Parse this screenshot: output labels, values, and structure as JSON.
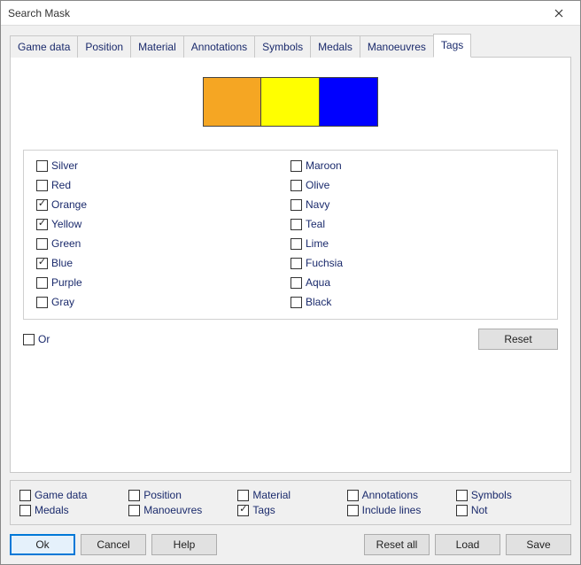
{
  "window": {
    "title": "Search Mask"
  },
  "tabs": [
    {
      "id": "game-data",
      "label": "Game data"
    },
    {
      "id": "position",
      "label": "Position"
    },
    {
      "id": "material",
      "label": "Material"
    },
    {
      "id": "annotations",
      "label": "Annotations"
    },
    {
      "id": "symbols",
      "label": "Symbols"
    },
    {
      "id": "medals",
      "label": "Medals"
    },
    {
      "id": "manoeuvres",
      "label": "Manoeuvres"
    },
    {
      "id": "tags",
      "label": "Tags"
    }
  ],
  "active_tab": "tags",
  "swatches": [
    {
      "name": "orange",
      "color": "#f5a623"
    },
    {
      "name": "yellow",
      "color": "#ffff00"
    },
    {
      "name": "blue",
      "color": "#0000ff"
    }
  ],
  "colors_left": [
    {
      "label": "Silver",
      "checked": false
    },
    {
      "label": "Red",
      "checked": false
    },
    {
      "label": "Orange",
      "checked": true
    },
    {
      "label": "Yellow",
      "checked": true
    },
    {
      "label": "Green",
      "checked": false
    },
    {
      "label": "Blue",
      "checked": true
    },
    {
      "label": "Purple",
      "checked": false
    },
    {
      "label": "Gray",
      "checked": false
    }
  ],
  "colors_right": [
    {
      "label": "Maroon",
      "checked": false
    },
    {
      "label": "Olive",
      "checked": false
    },
    {
      "label": "Navy",
      "checked": false
    },
    {
      "label": "Teal",
      "checked": false
    },
    {
      "label": "Lime",
      "checked": false
    },
    {
      "label": "Fuchsia",
      "checked": false
    },
    {
      "label": "Aqua",
      "checked": false
    },
    {
      "label": "Black",
      "checked": false
    }
  ],
  "or_checkbox": {
    "label": "Or",
    "checked": false
  },
  "reset_btn": "Reset",
  "footer_checks_row1": [
    {
      "label": "Game data",
      "checked": false
    },
    {
      "label": "Position",
      "checked": false
    },
    {
      "label": "Material",
      "checked": false
    },
    {
      "label": "Annotations",
      "checked": false
    },
    {
      "label": "Symbols",
      "checked": false
    }
  ],
  "footer_checks_row2": [
    {
      "label": "Medals",
      "checked": false
    },
    {
      "label": "Manoeuvres",
      "checked": false
    },
    {
      "label": "Tags",
      "checked": true
    },
    {
      "label": "Include lines",
      "checked": false
    },
    {
      "label": "Not",
      "checked": false
    }
  ],
  "buttons": {
    "ok": "Ok",
    "cancel": "Cancel",
    "help": "Help",
    "reset_all": "Reset all",
    "load": "Load",
    "save": "Save"
  }
}
